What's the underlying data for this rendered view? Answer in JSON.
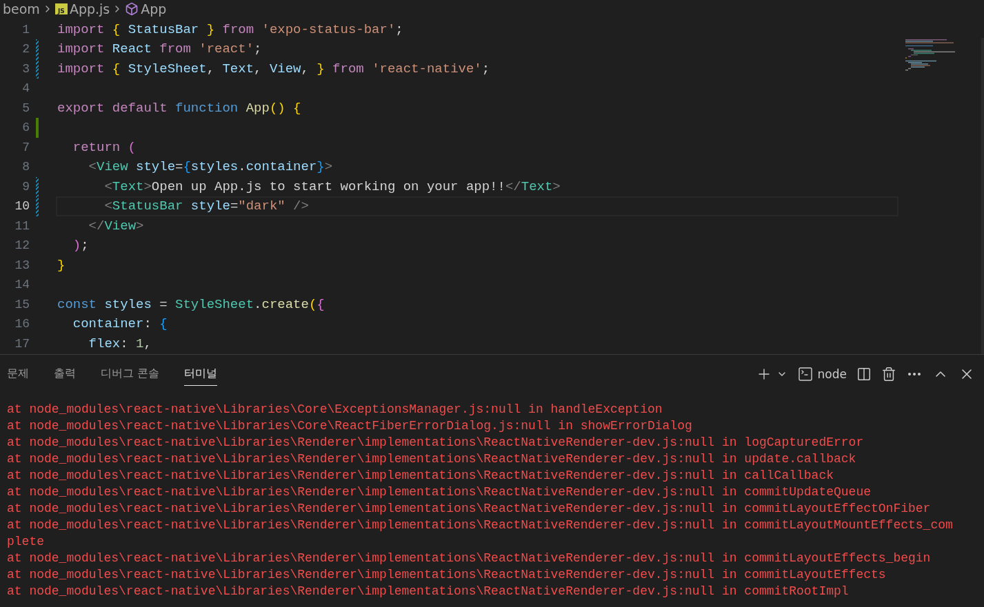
{
  "breadcrumb": [
    {
      "kind": "folder",
      "label": "beom"
    },
    {
      "kind": "file",
      "label": "App.js",
      "badge": "JS"
    },
    {
      "kind": "symbol",
      "label": "App"
    }
  ],
  "editor": {
    "lines": [
      {
        "number": "1",
        "modified": false,
        "added": false,
        "current": false,
        "tokens": [
          {
            "kind": "keyword",
            "text": "import"
          },
          {
            "kind": "bracket1",
            "text": " {"
          },
          {
            "kind": "variable",
            "text": " StatusBar"
          },
          {
            "kind": "bracket1",
            "text": " }"
          },
          {
            "kind": "keyword",
            "text": " from"
          },
          {
            "kind": "string",
            "text": " 'expo-status-bar'"
          },
          {
            "kind": "plain",
            "text": ";"
          }
        ]
      },
      {
        "number": "2",
        "modified": true,
        "added": false,
        "current": false,
        "tokens": [
          {
            "kind": "keyword",
            "text": "import"
          },
          {
            "kind": "variable",
            "text": " React"
          },
          {
            "kind": "keyword",
            "text": " from"
          },
          {
            "kind": "string",
            "text": " 'react'"
          },
          {
            "kind": "plain",
            "text": ";"
          }
        ]
      },
      {
        "number": "3",
        "modified": true,
        "added": false,
        "current": false,
        "tokens": [
          {
            "kind": "keyword",
            "text": "import"
          },
          {
            "kind": "bracket1",
            "text": " {"
          },
          {
            "kind": "variable",
            "text": " StyleSheet"
          },
          {
            "kind": "plain",
            "text": ","
          },
          {
            "kind": "variable",
            "text": " Text"
          },
          {
            "kind": "plain",
            "text": ","
          },
          {
            "kind": "variable",
            "text": " View"
          },
          {
            "kind": "plain",
            "text": ","
          },
          {
            "kind": "bracket1",
            "text": " }"
          },
          {
            "kind": "keyword",
            "text": " from"
          },
          {
            "kind": "string",
            "text": " 'react-native'"
          },
          {
            "kind": "plain",
            "text": ";"
          }
        ]
      },
      {
        "number": "4",
        "modified": false,
        "added": false,
        "current": false
      },
      {
        "number": "5",
        "modified": false,
        "added": false,
        "current": false,
        "tokens": [
          {
            "kind": "keyword",
            "text": "export default"
          },
          {
            "kind": "storage",
            "text": " function"
          },
          {
            "kind": "function",
            "text": " App"
          },
          {
            "kind": "bracket1",
            "text": "()"
          },
          {
            "kind": "bracket1",
            "text": " {"
          }
        ]
      },
      {
        "number": "6",
        "modified": false,
        "added": true,
        "current": false
      },
      {
        "number": "7",
        "modified": false,
        "added": false,
        "current": false,
        "tokens": [
          {
            "kind": "keyword",
            "text": "  return"
          },
          {
            "kind": "bracket2",
            "text": " ("
          }
        ]
      },
      {
        "number": "8",
        "modified": false,
        "added": false,
        "current": false,
        "tokens": [
          {
            "kind": "punctuation",
            "text": "    <"
          },
          {
            "kind": "tag",
            "text": "View"
          },
          {
            "kind": "variable",
            "text": " style"
          },
          {
            "kind": "plain",
            "text": "="
          },
          {
            "kind": "bracket3",
            "text": "{"
          },
          {
            "kind": "variable",
            "text": "styles"
          },
          {
            "kind": "plain",
            "text": "."
          },
          {
            "kind": "variable",
            "text": "container"
          },
          {
            "kind": "bracket3",
            "text": "}"
          },
          {
            "kind": "punctuation",
            "text": ">"
          }
        ]
      },
      {
        "number": "9",
        "modified": true,
        "added": false,
        "current": false,
        "tokens": [
          {
            "kind": "punctuation",
            "text": "      <"
          },
          {
            "kind": "tag",
            "text": "Text"
          },
          {
            "kind": "punctuation",
            "text": ">"
          },
          {
            "kind": "plain",
            "text": "Open up App.js to start working on your app!!"
          },
          {
            "kind": "punctuation",
            "text": "</"
          },
          {
            "kind": "tag",
            "text": "Text"
          },
          {
            "kind": "punctuation",
            "text": ">"
          }
        ]
      },
      {
        "number": "10",
        "modified": true,
        "added": false,
        "current": true,
        "tokens": [
          {
            "kind": "punctuation",
            "text": "      <"
          },
          {
            "kind": "tag",
            "text": "StatusBar"
          },
          {
            "kind": "variable",
            "text": " style"
          },
          {
            "kind": "plain",
            "text": "="
          },
          {
            "kind": "string",
            "text": "\"dark\""
          },
          {
            "kind": "punctuation",
            "text": " />"
          }
        ]
      },
      {
        "number": "11",
        "modified": false,
        "added": false,
        "current": false,
        "tokens": [
          {
            "kind": "punctuation",
            "text": "    </"
          },
          {
            "kind": "tag",
            "text": "View"
          },
          {
            "kind": "punctuation",
            "text": ">"
          }
        ]
      },
      {
        "number": "12",
        "modified": false,
        "added": false,
        "current": false,
        "tokens": [
          {
            "kind": "bracket2",
            "text": "  )"
          },
          {
            "kind": "plain",
            "text": ";"
          }
        ]
      },
      {
        "number": "13",
        "modified": false,
        "added": false,
        "current": false,
        "tokens": [
          {
            "kind": "bracket1",
            "text": "}"
          }
        ]
      },
      {
        "number": "14",
        "modified": false,
        "added": false,
        "current": false
      },
      {
        "number": "15",
        "modified": false,
        "added": false,
        "current": false,
        "tokens": [
          {
            "kind": "storage",
            "text": "const"
          },
          {
            "kind": "variable",
            "text": " styles"
          },
          {
            "kind": "plain",
            "text": " ="
          },
          {
            "kind": "class",
            "text": " StyleSheet"
          },
          {
            "kind": "plain",
            "text": "."
          },
          {
            "kind": "function",
            "text": "create"
          },
          {
            "kind": "bracket1",
            "text": "("
          },
          {
            "kind": "bracket2",
            "text": "{"
          }
        ]
      },
      {
        "number": "16",
        "modified": false,
        "added": false,
        "current": false,
        "tokens": [
          {
            "kind": "variable",
            "text": "  container"
          },
          {
            "kind": "plain",
            "text": ":"
          },
          {
            "kind": "bracket3",
            "text": " {"
          }
        ]
      },
      {
        "number": "17",
        "modified": false,
        "added": false,
        "current": false,
        "tokens": [
          {
            "kind": "variable",
            "text": "    flex"
          },
          {
            "kind": "plain",
            "text": ":"
          },
          {
            "kind": "number",
            "text": " 1"
          },
          {
            "kind": "plain",
            "text": ","
          }
        ]
      }
    ]
  },
  "panel": {
    "tabs": [
      {
        "label": "문제",
        "selected": false
      },
      {
        "label": "출력",
        "selected": false
      },
      {
        "label": "디버그 콘솔",
        "selected": false
      },
      {
        "label": "터미널",
        "selected": true
      }
    ],
    "terminal_name": "node",
    "terminal_lines": [
      "at node_modules\\react-native\\Libraries\\Core\\ExceptionsManager.js:null in handleException",
      "at node_modules\\react-native\\Libraries\\Core\\ReactFiberErrorDialog.js:null in showErrorDialog",
      "at node_modules\\react-native\\Libraries\\Renderer\\implementations\\ReactNativeRenderer-dev.js:null in logCapturedError",
      "at node_modules\\react-native\\Libraries\\Renderer\\implementations\\ReactNativeRenderer-dev.js:null in update.callback",
      "at node_modules\\react-native\\Libraries\\Renderer\\implementations\\ReactNativeRenderer-dev.js:null in callCallback",
      "at node_modules\\react-native\\Libraries\\Renderer\\implementations\\ReactNativeRenderer-dev.js:null in commitUpdateQueue",
      "at node_modules\\react-native\\Libraries\\Renderer\\implementations\\ReactNativeRenderer-dev.js:null in commitLayoutEffectOnFiber",
      "at node_modules\\react-native\\Libraries\\Renderer\\implementations\\ReactNativeRenderer-dev.js:null in commitLayoutMountEffects_com",
      "plete",
      "at node_modules\\react-native\\Libraries\\Renderer\\implementations\\ReactNativeRenderer-dev.js:null in commitLayoutEffects_begin",
      "at node_modules\\react-native\\Libraries\\Renderer\\implementations\\ReactNativeRenderer-dev.js:null in commitLayoutEffects",
      "at node_modules\\react-native\\Libraries\\Renderer\\implementations\\ReactNativeRenderer-dev.js:null in commitRootImpl"
    ]
  }
}
